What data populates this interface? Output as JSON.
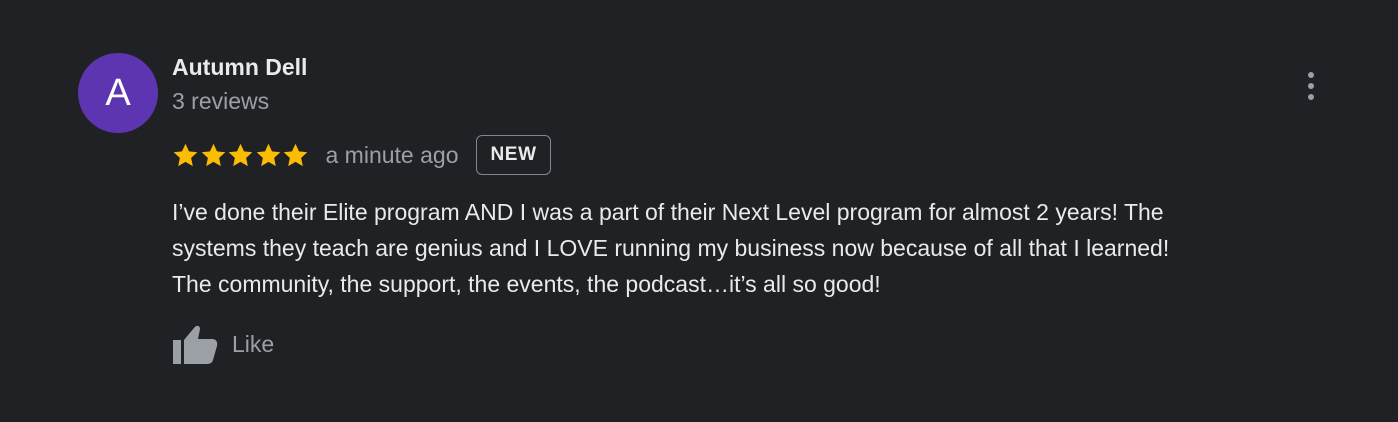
{
  "review": {
    "avatar_letter": "A",
    "avatar_color": "#5e35b1",
    "author": "Autumn Dell",
    "reviews_count": "3 reviews",
    "rating": 5,
    "rating_max": 5,
    "timestamp": "a minute ago",
    "badge": "NEW",
    "text": "I’ve done their Elite program AND I was a part of their Next Level program for almost 2 years! The\nsystems they teach are genius and I LOVE running my business now because of all that I learned!\nThe community, the support, the events, the podcast…it’s all so good!",
    "like_label": "Like",
    "star_color": "#fbbc04",
    "more_icon": "more-vert-icon",
    "like_icon": "thumb-up-icon"
  }
}
